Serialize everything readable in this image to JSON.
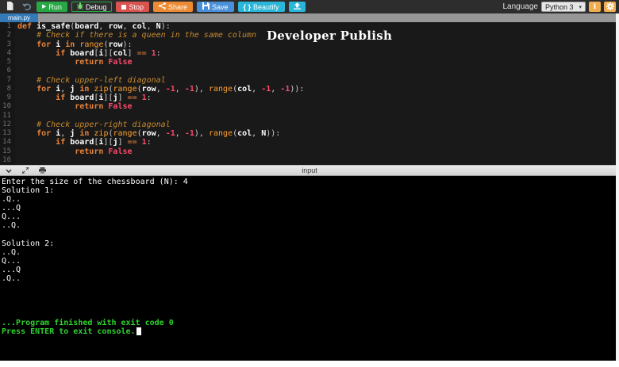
{
  "toolbar": {
    "run": "Run",
    "debug": "Debug",
    "stop": "Stop",
    "share": "Share",
    "save": "Save",
    "beautify_icon": "{ }",
    "beautify": "Beautify",
    "language_label": "Language",
    "language_value": "Python 3",
    "info": "i"
  },
  "tab": {
    "label": "main.py"
  },
  "watermark": "Developer Publish",
  "editor": {
    "lines": [
      {
        "num": 1,
        "tokens": [
          [
            "kw",
            "def"
          ],
          [
            "pln",
            " "
          ],
          [
            "fn",
            "is_safe"
          ],
          [
            "pln",
            "("
          ],
          [
            "id",
            "board"
          ],
          [
            "pln",
            ", "
          ],
          [
            "id",
            "row"
          ],
          [
            "pln",
            ", "
          ],
          [
            "id",
            "col"
          ],
          [
            "pln",
            ", "
          ],
          [
            "id",
            "N"
          ],
          [
            "pln",
            "):"
          ]
        ]
      },
      {
        "num": 2,
        "tokens": [
          [
            "pln",
            "    "
          ],
          [
            "cmt",
            "# Check if there is a queen in the same column"
          ]
        ]
      },
      {
        "num": 3,
        "tokens": [
          [
            "pln",
            "    "
          ],
          [
            "kw",
            "for"
          ],
          [
            "pln",
            " "
          ],
          [
            "id",
            "i"
          ],
          [
            "pln",
            " "
          ],
          [
            "kw",
            "in"
          ],
          [
            "pln",
            " "
          ],
          [
            "bi",
            "range"
          ],
          [
            "pln",
            "("
          ],
          [
            "id",
            "row"
          ],
          [
            "pln",
            "):"
          ]
        ]
      },
      {
        "num": 4,
        "tokens": [
          [
            "pln",
            "        "
          ],
          [
            "kw",
            "if"
          ],
          [
            "pln",
            " "
          ],
          [
            "id",
            "board"
          ],
          [
            "pln",
            "["
          ],
          [
            "id",
            "i"
          ],
          [
            "pln",
            "]["
          ],
          [
            "id",
            "col"
          ],
          [
            "pln",
            "] "
          ],
          [
            "op",
            "=="
          ],
          [
            "pln",
            " "
          ],
          [
            "num",
            "1"
          ],
          [
            "pln",
            ":"
          ]
        ]
      },
      {
        "num": 5,
        "tokens": [
          [
            "pln",
            "            "
          ],
          [
            "kw",
            "return"
          ],
          [
            "pln",
            " "
          ],
          [
            "bool",
            "False"
          ]
        ]
      },
      {
        "num": 6,
        "tokens": []
      },
      {
        "num": 7,
        "tokens": [
          [
            "pln",
            "    "
          ],
          [
            "cmt",
            "# Check upper-left diagonal"
          ]
        ]
      },
      {
        "num": 8,
        "tokens": [
          [
            "pln",
            "    "
          ],
          [
            "kw",
            "for"
          ],
          [
            "pln",
            " "
          ],
          [
            "id",
            "i"
          ],
          [
            "pln",
            ", "
          ],
          [
            "id",
            "j"
          ],
          [
            "pln",
            " "
          ],
          [
            "kw",
            "in"
          ],
          [
            "pln",
            " "
          ],
          [
            "bi",
            "zip"
          ],
          [
            "pln",
            "("
          ],
          [
            "bi",
            "range"
          ],
          [
            "pln",
            "("
          ],
          [
            "id",
            "row"
          ],
          [
            "pln",
            ", "
          ],
          [
            "num",
            "-1"
          ],
          [
            "pln",
            ", "
          ],
          [
            "num",
            "-1"
          ],
          [
            "pln",
            "), "
          ],
          [
            "bi",
            "range"
          ],
          [
            "pln",
            "("
          ],
          [
            "id",
            "col"
          ],
          [
            "pln",
            ", "
          ],
          [
            "num",
            "-1"
          ],
          [
            "pln",
            ", "
          ],
          [
            "num",
            "-1"
          ],
          [
            "pln",
            ")):"
          ]
        ]
      },
      {
        "num": 9,
        "tokens": [
          [
            "pln",
            "        "
          ],
          [
            "kw",
            "if"
          ],
          [
            "pln",
            " "
          ],
          [
            "id",
            "board"
          ],
          [
            "pln",
            "["
          ],
          [
            "id",
            "i"
          ],
          [
            "pln",
            "]["
          ],
          [
            "id",
            "j"
          ],
          [
            "pln",
            "] "
          ],
          [
            "op",
            "=="
          ],
          [
            "pln",
            " "
          ],
          [
            "num",
            "1"
          ],
          [
            "pln",
            ":"
          ]
        ]
      },
      {
        "num": 10,
        "tokens": [
          [
            "pln",
            "            "
          ],
          [
            "kw",
            "return"
          ],
          [
            "pln",
            " "
          ],
          [
            "bool",
            "False"
          ]
        ]
      },
      {
        "num": 11,
        "tokens": []
      },
      {
        "num": 12,
        "tokens": [
          [
            "pln",
            "    "
          ],
          [
            "cmt",
            "# Check upper-right diagonal"
          ]
        ]
      },
      {
        "num": 13,
        "tokens": [
          [
            "pln",
            "    "
          ],
          [
            "kw",
            "for"
          ],
          [
            "pln",
            " "
          ],
          [
            "id",
            "i"
          ],
          [
            "pln",
            ", "
          ],
          [
            "id",
            "j"
          ],
          [
            "pln",
            " "
          ],
          [
            "kw",
            "in"
          ],
          [
            "pln",
            " "
          ],
          [
            "bi",
            "zip"
          ],
          [
            "pln",
            "("
          ],
          [
            "bi",
            "range"
          ],
          [
            "pln",
            "("
          ],
          [
            "id",
            "row"
          ],
          [
            "pln",
            ", "
          ],
          [
            "num",
            "-1"
          ],
          [
            "pln",
            ", "
          ],
          [
            "num",
            "-1"
          ],
          [
            "pln",
            "), "
          ],
          [
            "bi",
            "range"
          ],
          [
            "pln",
            "("
          ],
          [
            "id",
            "col"
          ],
          [
            "pln",
            ", "
          ],
          [
            "id",
            "N"
          ],
          [
            "pln",
            ")):"
          ]
        ]
      },
      {
        "num": 14,
        "tokens": [
          [
            "pln",
            "        "
          ],
          [
            "kw",
            "if"
          ],
          [
            "pln",
            " "
          ],
          [
            "id",
            "board"
          ],
          [
            "pln",
            "["
          ],
          [
            "id",
            "i"
          ],
          [
            "pln",
            "]["
          ],
          [
            "id",
            "j"
          ],
          [
            "pln",
            "] "
          ],
          [
            "op",
            "=="
          ],
          [
            "pln",
            " "
          ],
          [
            "num",
            "1"
          ],
          [
            "pln",
            ":"
          ]
        ]
      },
      {
        "num": 15,
        "tokens": [
          [
            "pln",
            "            "
          ],
          [
            "kw",
            "return"
          ],
          [
            "pln",
            " "
          ],
          [
            "bool",
            "False"
          ]
        ]
      },
      {
        "num": 16,
        "tokens": []
      }
    ]
  },
  "console_header": {
    "label": "input"
  },
  "console": {
    "lines": [
      {
        "text": "Enter the size of the chessboard (N): 4",
        "color": "white"
      },
      {
        "text": "Solution 1:",
        "color": "white"
      },
      {
        "text": ".Q..",
        "color": "white"
      },
      {
        "text": "...Q",
        "color": "white"
      },
      {
        "text": "Q...",
        "color": "white"
      },
      {
        "text": "..Q.",
        "color": "white"
      },
      {
        "text": "",
        "color": "white"
      },
      {
        "text": "Solution 2:",
        "color": "white"
      },
      {
        "text": "..Q.",
        "color": "white"
      },
      {
        "text": "Q...",
        "color": "white"
      },
      {
        "text": "...Q",
        "color": "white"
      },
      {
        "text": ".Q..",
        "color": "white"
      },
      {
        "text": "",
        "color": "white"
      },
      {
        "text": "",
        "color": "white"
      },
      {
        "text": "",
        "color": "white"
      },
      {
        "text": "",
        "color": "white"
      },
      {
        "text": "...Program finished with exit code 0",
        "color": "green"
      },
      {
        "text": "Press ENTER to exit console.",
        "color": "green",
        "cursor": true
      }
    ]
  },
  "colors": {
    "run": "#28a745",
    "stop": "#d9534f",
    "share": "#ec8b33",
    "save": "#4a90d9",
    "beautify": "#29b6d8",
    "tab": "#337ab7",
    "info": "#f0ad4e",
    "gear": "#f0ad4e",
    "console_green": "#2ed32e",
    "kw": "#e8833a",
    "builtin": "#ffa02e",
    "comment": "#c98a2e",
    "number": "#ff4a6b",
    "bool": "#ff4a6b",
    "ident": "#ffffff"
  }
}
